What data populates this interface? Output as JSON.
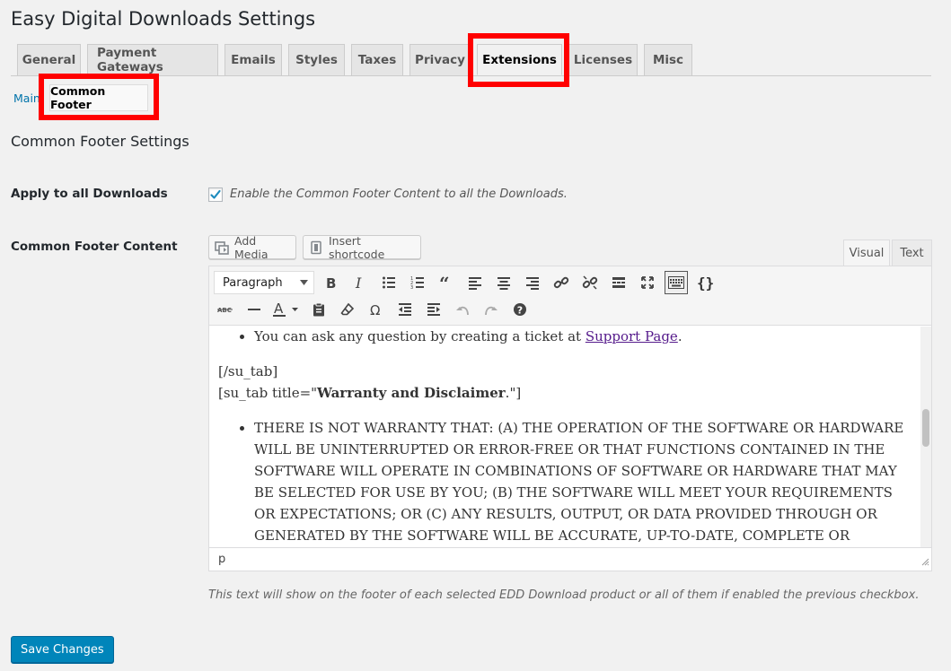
{
  "page": {
    "title": "Easy Digital Downloads Settings"
  },
  "tabs": [
    {
      "label": "General"
    },
    {
      "label": "Payment Gateways"
    },
    {
      "label": "Emails"
    },
    {
      "label": "Styles"
    },
    {
      "label": "Taxes"
    },
    {
      "label": "Privacy"
    },
    {
      "label": "Extensions",
      "active": true
    },
    {
      "label": "Licenses"
    },
    {
      "label": "Misc"
    }
  ],
  "subnav": {
    "main": "Main",
    "current": "Common Footer"
  },
  "section": {
    "title": "Common Footer Settings"
  },
  "apply": {
    "label": "Apply to all Downloads",
    "checked": true,
    "description": "Enable the Common Footer Content to all the Downloads."
  },
  "content_field": {
    "label": "Common Footer Content",
    "add_media": "Add Media",
    "insert_shortcode": "Insert shortcode",
    "tab_visual": "Visual",
    "tab_text": "Text",
    "format_select": "Paragraph",
    "body": {
      "bullet1_prefix": "You can ask any question by creating a ticket at ",
      "bullet1_link": "Support Page",
      "bullet1_suffix": ".",
      "line_close": "[/su_tab]",
      "line_open_prefix": "[su_tab title=\"",
      "line_open_bold": "Warranty and Disclaimer",
      "line_open_suffix": ".\"]",
      "bullet2": "THERE IS NOT WARRANTY THAT: (A) THE OPERATION OF THE SOFTWARE OR HARDWARE WILL BE UNINTERRUPTED OR ERROR-FREE OR THAT FUNCTIONS CONTAINED IN THE SOFTWARE WILL OPERATE IN COMBINATIONS OF SOFTWARE OR HARDWARE THAT MAY BE SELECTED FOR USE BY YOU; (B) THE SOFTWARE WILL MEET YOUR REQUIREMENTS OR EXPECTATIONS; OR (C) ANY RESULTS, OUTPUT, OR DATA PROVIDED THROUGH OR GENERATED BY THE SOFTWARE WILL BE ACCURATE, UP-TO-DATE, COMPLETE OR RELIABLE. EXCEPT AS"
    },
    "path": "p",
    "help": "This text will show on the footer of each selected EDD Download product or all of them if enabled the previous checkbox."
  },
  "save_button": "Save Changes",
  "colors": {
    "accent": "#0085ba",
    "highlight": "#ff0000",
    "link": "#0073aa"
  }
}
